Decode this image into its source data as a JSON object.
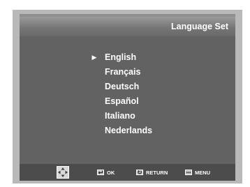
{
  "screen": {
    "title": "Language Set",
    "languages": [
      "English",
      "Français",
      "Deutsch",
      "Español",
      "Italiano",
      "Nederlands"
    ],
    "selected_index": 0,
    "cursor_glyph": "▶"
  },
  "hints": {
    "ok_label": "OK",
    "return_label": "RETURN",
    "menu_label": "MENU"
  },
  "colors": {
    "panel": "#626262",
    "title_bar": "#747474",
    "bottom_bar": "#4c4c4c",
    "frame": "#b9b9b9",
    "text": "#ffffff"
  }
}
